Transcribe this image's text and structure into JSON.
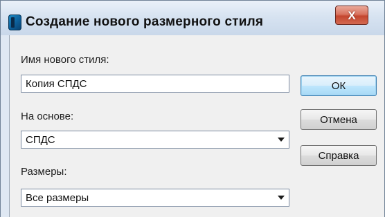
{
  "dialog": {
    "title": "Создание нового размерного стиля",
    "close_glyph": "X"
  },
  "form": {
    "name_label": "Имя нового стиля:",
    "name_value": "Копия СПДС",
    "base_label": "На основе:",
    "base_value": "СПДС",
    "dims_label": "Размеры:",
    "dims_value": "Все размеры"
  },
  "buttons": {
    "ok": "ОК",
    "cancel": "Отмена",
    "help": "Справка"
  },
  "icons": {
    "app": "autocad-app-icon",
    "close": "close-icon",
    "dropdown": "chevron-down-icon"
  },
  "colors": {
    "close_button": "#c4462f",
    "default_button_border": "#3c7fb1",
    "client_background": "#f0f0f0"
  }
}
